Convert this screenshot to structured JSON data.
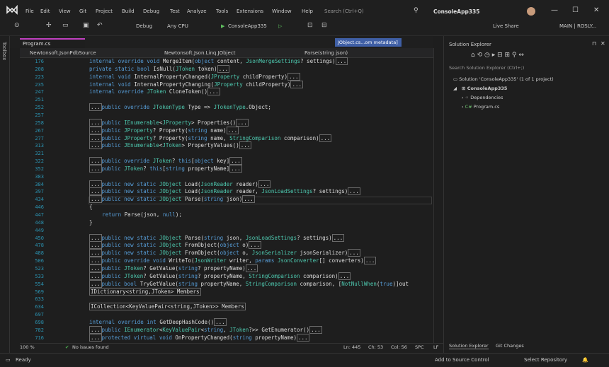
{
  "menu": [
    "File",
    "Edit",
    "View",
    "Git",
    "Project",
    "Build",
    "Debug",
    "Test",
    "Analyze",
    "Tools",
    "Extensions",
    "Window",
    "Help"
  ],
  "search_placeholder": "Search (Ctrl+Q)",
  "window_title": "ConsoleApp335",
  "toolbar": {
    "config": "Debug",
    "platform": "Any CPU",
    "run": "ConsoleApp335",
    "live_share": "Live Share",
    "branch": "MAIN | ROSLY..."
  },
  "toolbox_label": "Toolbox",
  "tabs": {
    "active": "Program.cs",
    "preview": "JObject.cs...om metadata]"
  },
  "nav": {
    "project": "Newtonsoft.JsonPdbSource",
    "type": "Newtonsoft.Json.Linq.JObject",
    "member": "Parse(string json)"
  },
  "lines": [
    {
      "n": "176",
      "html": "<span class='kw'>internal override void</span> MergeItem(<span class='kw'>object</span> content, <span class='ty'>JsonMergeSettings</span>? settings)<span class='collapsed'>...</span>"
    },
    {
      "n": "208",
      "html": "<span class='kw'>private static bool</span> IsNull(<span class='ty'>JToken</span> token)<span class='collapsed'>...</span>"
    },
    {
      "n": "223",
      "html": "<span class='kw'>internal void</span> InternalPropertyChanged(<span class='ty'>JProperty</span> childProperty)<span class='collapsed'>...</span>"
    },
    {
      "n": "235",
      "html": "<span class='kw'>internal void</span> InternalPropertyChanging(<span class='ty'>JProperty</span> childProperty)<span class='collapsed'>...</span>"
    },
    {
      "n": "247",
      "html": "<span class='kw'>internal override</span> <span class='ty'>JToken</span> CloneToken()<span class='collapsed'>...</span>"
    },
    {
      "n": "251",
      "html": ""
    },
    {
      "n": "252",
      "html": "<span class='collapsed'>...</span><span class='kw'>public override</span> <span class='ty'>JTokenType</span> Type =&gt; <span class='ty'>JTokenType</span>.Object;"
    },
    {
      "n": "257",
      "html": ""
    },
    {
      "n": "258",
      "html": "<span class='collapsed'>...</span><span class='kw'>public</span> <span class='ty'>IEnumerable</span>&lt;<span class='ty'>JProperty</span>&gt; Properties()<span class='collapsed'>...</span>"
    },
    {
      "n": "267",
      "html": "<span class='collapsed'>...</span><span class='kw'>public</span> <span class='ty'>JProperty</span>? Property(<span class='kw'>string</span> name)<span class='collapsed'>...</span>"
    },
    {
      "n": "277",
      "html": "<span class='collapsed'>...</span><span class='kw'>public</span> <span class='ty'>JProperty</span>? Property(<span class='kw'>string</span> name, <span class='ty'>StringComparison</span> comparison)<span class='collapsed'>...</span>"
    },
    {
      "n": "313",
      "html": "<span class='collapsed'>...</span><span class='kw'>public</span> <span class='ty'>JEnumerable</span>&lt;<span class='ty'>JToken</span>&gt; PropertyValues()<span class='collapsed'>...</span>"
    },
    {
      "n": "321",
      "html": ""
    },
    {
      "n": "322",
      "html": "<span class='collapsed'>...</span><span class='kw'>public override</span> <span class='ty'>JToken</span>? <span class='kw'>this</span>[<span class='kw'>object</span> key]<span class='collapsed'>...</span>"
    },
    {
      "n": "352",
      "html": "<span class='collapsed'>...</span><span class='kw'>public</span> <span class='ty'>JToken</span>? <span class='kw'>this</span>[<span class='kw'>string</span> propertyName]<span class='collapsed'>...</span>"
    },
    {
      "n": "383",
      "html": ""
    },
    {
      "n": "384",
      "html": "<span class='collapsed'>...</span><span class='kw'>public new static</span> <span class='ty'>JObject</span> Load(<span class='ty'>JsonReader</span> reader)<span class='collapsed'>...</span>"
    },
    {
      "n": "397",
      "html": "<span class='collapsed'>...</span><span class='kw'>public new static</span> <span class='ty'>JObject</span> Load(<span class='ty'>JsonReader</span> reader, <span class='ty'>JsonLoadSettings</span>? settings)<span class='collapsed'>...</span>"
    },
    {
      "n": "434",
      "html": "<span class='collapsed'>...</span><span class='kw'>public new static</span> <span class='ty'>JObject</span> Parse(<span class='kw'>string</span> json)<span class='collapsed'>...</span>"
    },
    {
      "n": "446",
      "html": "{"
    },
    {
      "n": "447",
      "html": "    <span class='kw'>return</span> Parse(json, <span class='kw'>null</span>);"
    },
    {
      "n": "448",
      "html": "}"
    },
    {
      "n": "449",
      "html": ""
    },
    {
      "n": "450",
      "html": "<span class='collapsed'>...</span><span class='kw'>public new static</span> <span class='ty'>JObject</span> Parse(<span class='kw'>string</span> json, <span class='ty'>JsonLoadSettings</span>? settings)<span class='collapsed'>...</span>"
    },
    {
      "n": "478",
      "html": "<span class='collapsed'>...</span><span class='kw'>public new static</span> <span class='ty'>JObject</span> FromObject(<span class='kw'>object</span> o)<span class='collapsed'>...</span>"
    },
    {
      "n": "488",
      "html": "<span class='collapsed'>...</span><span class='kw'>public new static</span> <span class='ty'>JObject</span> FromObject(<span class='kw'>object</span> o, <span class='ty'>JsonSerializer</span> jsonSerializer)<span class='collapsed'>...</span>"
    },
    {
      "n": "506",
      "html": "<span class='collapsed'>...</span><span class='kw'>public override void</span> WriteTo(<span class='ty'>JsonWriter</span> writer, <span class='kw'>params</span> <span class='ty'>JsonConverter</span>[] converters)<span class='collapsed'>...</span>"
    },
    {
      "n": "523",
      "html": "<span class='collapsed'>...</span><span class='kw'>public</span> <span class='ty'>JToken</span>? GetValue(<span class='kw'>string</span>? propertyName)<span class='collapsed'>...</span>"
    },
    {
      "n": "533",
      "html": "<span class='collapsed'>...</span><span class='kw'>public</span> <span class='ty'>JToken</span>? GetValue(<span class='kw'>string</span>? propertyName, <span class='ty'>StringComparison</span> comparison)<span class='collapsed'>...</span>"
    },
    {
      "n": "554",
      "html": "<span class='collapsed'>...</span><span class='kw'>public bool</span> TryGetValue(<span class='kw'>string</span> propertyName, <span class='ty'>StringComparison</span> comparison, [<span class='ty'>NotNullWhen</span>(<span class='kw'>true</span>)]out"
    },
    {
      "n": "569",
      "html": "<span class='collapsed'>IDictionary&lt;string,JToken&gt; Members</span>"
    },
    {
      "n": "633",
      "html": ""
    },
    {
      "n": "634",
      "html": "<span class='collapsed'>ICollection&lt;KeyValuePair&lt;string,JToken&gt;&gt; Members</span>"
    },
    {
      "n": "697",
      "html": ""
    },
    {
      "n": "698",
      "html": "<span class='kw'>internal override int</span> GetDeepHashCode()<span class='collapsed'>...</span>"
    },
    {
      "n": "782",
      "html": "<span class='collapsed'>...</span><span class='kw'>public</span> <span class='ty'>IEnumerator</span>&lt;<span class='ty'>KeyValuePair</span>&lt;<span class='kw'>string</span>, <span class='ty'>JToken</span>?&gt;&gt; GetEnumerator()<span class='collapsed'>...</span>"
    },
    {
      "n": "716",
      "html": "<span class='collapsed'>...</span><span class='kw'>protected virtual void</span> OnPropertyChanged(<span class='kw'>string</span> propertyName)<span class='collapsed'>...</span>"
    }
  ],
  "editor_status": {
    "zoom": "100 %",
    "issues": "No issues found",
    "ln": "Ln: 445",
    "ch": "Ch: 53",
    "col": "Col: 56",
    "spc": "SPC",
    "lf": "LF"
  },
  "solution_explorer": {
    "title": "Solution Explorer",
    "search": "Search Solution Explorer (Ctrl+;)",
    "solution": "Solution 'ConsoleApp335' (1 of 1 project)",
    "project": "ConsoleApp335",
    "deps": "Dependencies",
    "file": "Program.cs",
    "tab1": "Solution Explorer",
    "tab2": "Git Changes"
  },
  "statusbar": {
    "ready": "Ready",
    "add_source": "Add to Source Control",
    "repo": "Select Repository"
  }
}
